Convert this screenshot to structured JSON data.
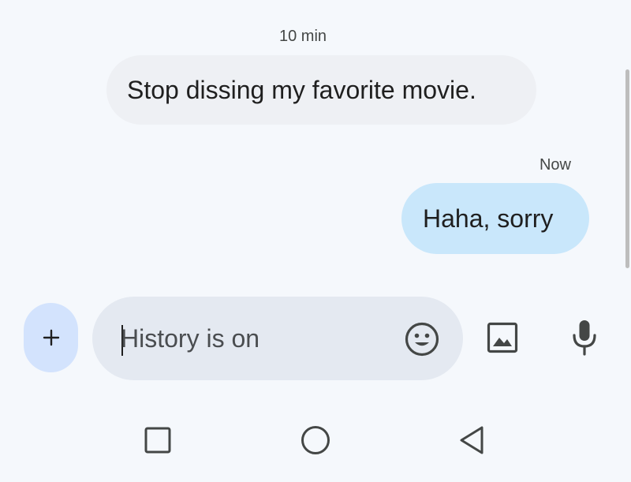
{
  "conversation": {
    "messages": [
      {
        "direction": "incoming",
        "timestamp": "10 min",
        "text": "Stop dissing my favorite movie."
      },
      {
        "direction": "outgoing",
        "timestamp": "Now",
        "text": "Haha, sorry"
      }
    ]
  },
  "composer": {
    "attach_label": "+",
    "placeholder": "History is on",
    "value": "",
    "icons": {
      "emoji": "emoji-icon",
      "gallery": "image-icon",
      "mic": "microphone-icon"
    }
  },
  "navbar": {
    "icons": [
      "recents-square-icon",
      "home-circle-icon",
      "back-triangle-icon"
    ]
  },
  "colors": {
    "background": "#f5f8fc",
    "incoming_bubble": "#eef0f4",
    "outgoing_bubble": "#c9e7fb",
    "compose_field": "#e4e9f1",
    "attach_button": "#d3e3fd",
    "icon": "#444746"
  }
}
